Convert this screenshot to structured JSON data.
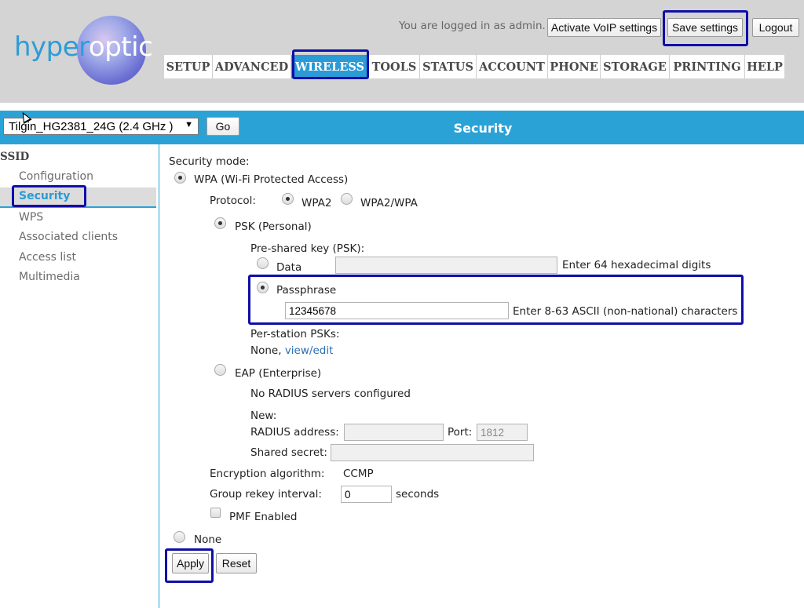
{
  "brand": {
    "logo_text": "hyperoptic",
    "logo_dark_part": "hyper",
    "logo_light_part": "op",
    "logo_end_part": "tic"
  },
  "header": {
    "logged_in_text": "You are logged in as admin.",
    "activate_voip_label": "Activate VoIP settings",
    "save_settings_label": "Save settings",
    "logout_label": "Logout"
  },
  "nav": {
    "items": [
      "SETUP",
      "ADVANCED",
      "WIRELESS",
      "TOOLS",
      "STATUS",
      "ACCOUNT",
      "PHONE",
      "STORAGE",
      "PRINTING",
      "HELP"
    ],
    "active": "WIRELESS"
  },
  "toolbar": {
    "ssid_selected": "Tilgin_HG2381_24G (2.4 GHz )",
    "go_label": "Go",
    "page_title": "Security"
  },
  "sidebar": {
    "heading": "SSID",
    "items": [
      "Configuration",
      "Security",
      "WPS",
      "Associated clients",
      "Access list",
      "Multimedia"
    ],
    "active": "Security"
  },
  "form": {
    "security_mode_label": "Security mode:",
    "wpa_label": "WPA (Wi-Fi Protected Access)",
    "protocol_label": "Protocol:",
    "wpa2_label": "WPA2",
    "wpa2wpa_label": "WPA2/WPA",
    "psk_label": "PSK (Personal)",
    "psk_key_label": "Pre-shared key (PSK):",
    "data_label": "Data",
    "data_value": "",
    "data_hint": "Enter 64 hexadecimal digits",
    "passphrase_label": "Passphrase",
    "passphrase_value": "12345678",
    "passphrase_hint": "Enter 8-63 ASCII (non-national) characters",
    "per_station_label": "Per-station PSKs:",
    "per_station_value": "None,",
    "per_station_link": "view/edit",
    "eap_label": "EAP (Enterprise)",
    "no_radius_text": "No RADIUS servers configured",
    "new_label": "New:",
    "radius_address_label": "RADIUS address:",
    "radius_address_value": "",
    "port_label": "Port:",
    "port_value": "1812",
    "shared_secret_label": "Shared secret:",
    "shared_secret_value": "",
    "encryption_label": "Encryption algorithm:",
    "encryption_value": "CCMP",
    "rekey_label": "Group rekey interval:",
    "rekey_value": "0",
    "rekey_unit": "seconds",
    "pmf_label": "PMF Enabled",
    "none_label": "None",
    "apply_label": "Apply",
    "reset_label": "Reset"
  },
  "colors": {
    "accent": "#2aa2d6",
    "highlight": "#0f0fa6",
    "header_bg": "#d4d4d4"
  }
}
